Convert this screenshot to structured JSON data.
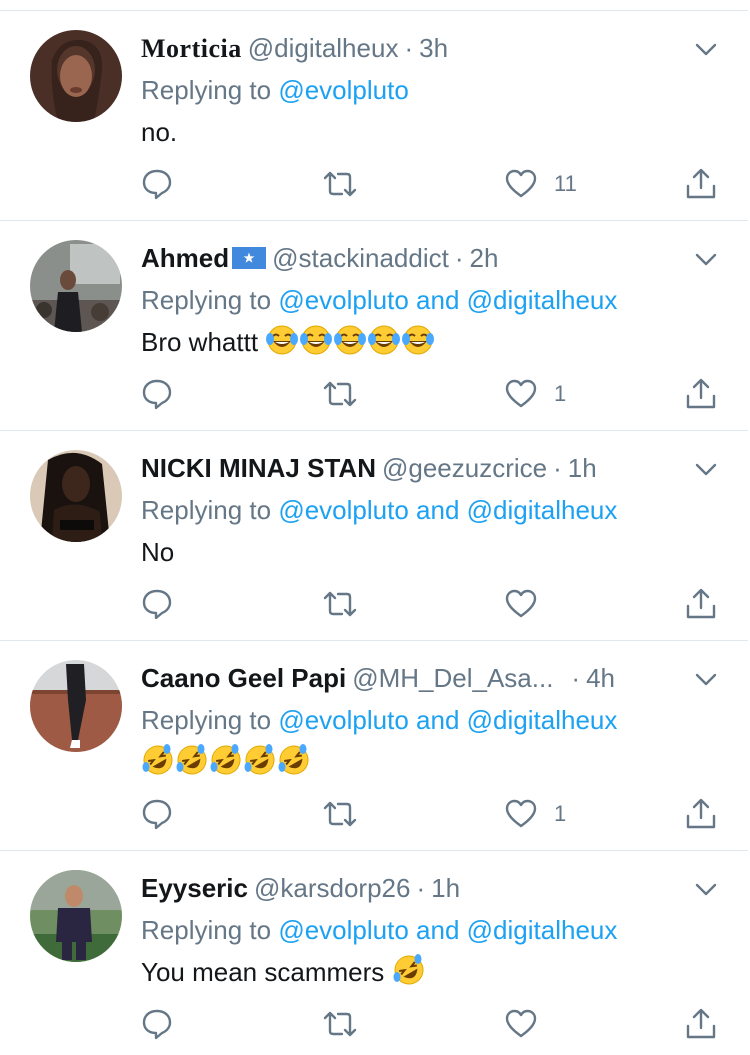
{
  "tweets": [
    {
      "name": "Morticia",
      "handle": "@digitalheux",
      "time": "3h",
      "reply_prefix": "Replying to",
      "reply_to": "@evolpluto",
      "reply_and": "",
      "reply_to2": "",
      "text": "no.",
      "emojis": [],
      "likes": "11",
      "avatar_color": "#5a3c32"
    },
    {
      "name": "Ahmed",
      "has_flag": true,
      "handle": "@stackinaddict",
      "time": "2h",
      "reply_prefix": "Replying to",
      "reply_to": "@evolpluto",
      "reply_and": "and",
      "reply_to2": "@digitalheux",
      "text": "Bro whattt",
      "emojis": [
        "face-with-tears-of-joy",
        "face-with-tears-of-joy",
        "face-with-tears-of-joy",
        "face-with-tears-of-joy",
        "face-with-tears-of-joy"
      ],
      "likes": "1",
      "avatar_color": "#6f7372"
    },
    {
      "name": "NICKI MINAJ STAN",
      "handle": "@geezuzcrice",
      "time": "1h",
      "reply_prefix": "Replying to",
      "reply_to": "@evolpluto",
      "reply_and": "and",
      "reply_to2": "@digitalheux",
      "text": "No",
      "emojis": [],
      "likes": "",
      "avatar_color": "#3b2a22"
    },
    {
      "name": "Caano Geel Papi",
      "handle": "@MH_Del_Asa...",
      "time": "4h",
      "reply_prefix": "Replying to",
      "reply_to": "@evolpluto",
      "reply_and": "and",
      "reply_to2": "@digitalheux",
      "text": "",
      "emojis": [
        "rolling-on-floor-laughing",
        "rolling-on-floor-laughing",
        "rolling-on-floor-laughing",
        "rolling-on-floor-laughing",
        "rolling-on-floor-laughing"
      ],
      "likes": "1",
      "avatar_color": "#b9bcbe"
    },
    {
      "name": "Eyyseric",
      "handle": "@karsdorp26",
      "time": "1h",
      "reply_prefix": "Replying to",
      "reply_to": "@evolpluto",
      "reply_and": "and",
      "reply_to2": "@digitalheux",
      "text": "You mean scammers",
      "emojis": [
        "rolling-on-floor-laughing"
      ],
      "likes": "",
      "avatar_color": "#4f6b45"
    }
  ],
  "colors": {
    "link": "#1da1f2",
    "muted": "#657786",
    "text": "#14171a",
    "divider": "#e1e8ed"
  },
  "icons": {
    "reply": "speech-bubble-icon",
    "retweet": "retweet-arrows-icon",
    "like": "heart-icon",
    "share": "share-upload-icon",
    "menu": "chevron-down-icon"
  }
}
